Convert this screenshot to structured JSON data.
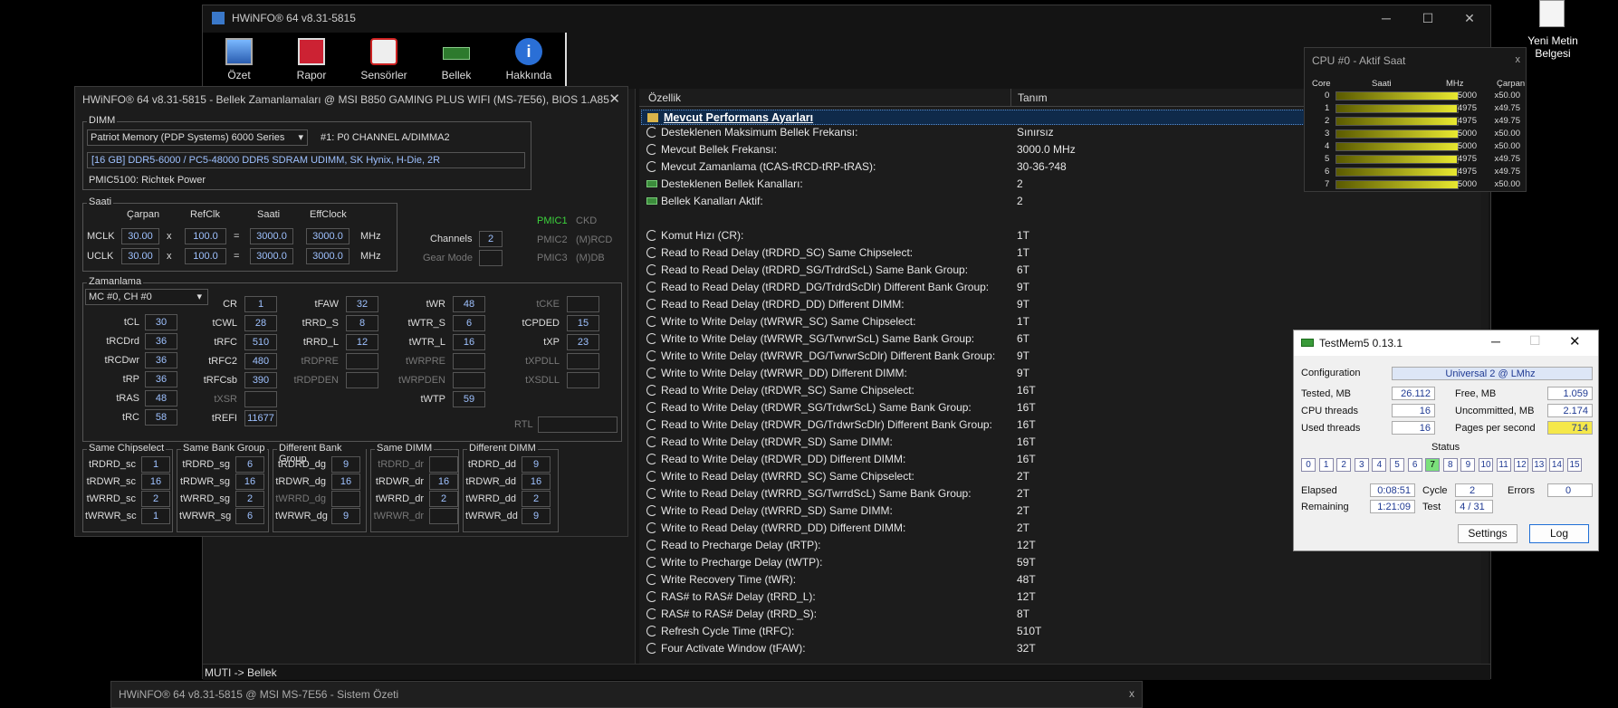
{
  "desktop": {
    "file_icon": "file-icon",
    "file_label1": "Yeni Metin",
    "file_label2": "Belgesi"
  },
  "main": {
    "title": "HWiNFO® 64 v8.31-5815",
    "toolbar": [
      {
        "label": "Özet",
        "icon": "monitor-icon"
      },
      {
        "label": "Rapor",
        "icon": "save-icon"
      },
      {
        "label": "Sensörler",
        "icon": "thermometer-icon"
      },
      {
        "label": "Bellek",
        "icon": "ram-icon"
      },
      {
        "label": "Hakkında",
        "icon": "info-icon"
      }
    ],
    "status": "MUTI -> Bellek",
    "table": {
      "col_feature": "Özellik",
      "col_desc": "Tanım",
      "section": "Mevcut Performans Ayarları",
      "rows": [
        {
          "icon": "clock",
          "name": "Desteklenen Maksimum Bellek Frekansı:",
          "value": "Sınırsız"
        },
        {
          "icon": "clock",
          "name": "Mevcut Bellek Frekansı:",
          "value": "3000.0 MHz"
        },
        {
          "icon": "clock",
          "name": "Mevcut Zamanlama (tCAS-tRCD-tRP-tRAS):",
          "value": "30-36-?48"
        },
        {
          "icon": "ram",
          "name": "Desteklenen Bellek Kanalları:",
          "value": "2"
        },
        {
          "icon": "ram",
          "name": "Bellek Kanalları Aktif:",
          "value": "2"
        },
        {
          "icon": "none",
          "name": "",
          "value": ""
        },
        {
          "icon": "clock",
          "name": "Komut Hızı (CR):",
          "value": "1T"
        },
        {
          "icon": "clock",
          "name": "Read to Read Delay (tRDRD_SC) Same Chipselect:",
          "value": "1T"
        },
        {
          "icon": "clock",
          "name": "Read to Read Delay (tRDRD_SG/TrdrdScL) Same Bank Group:",
          "value": "6T"
        },
        {
          "icon": "clock",
          "name": "Read to Read Delay (tRDRD_DG/TrdrdScDlr) Different Bank Group:",
          "value": "9T"
        },
        {
          "icon": "clock",
          "name": "Read to Read Delay (tRDRD_DD) Different DIMM:",
          "value": "9T"
        },
        {
          "icon": "clock",
          "name": "Write to Write Delay (tWRWR_SC) Same Chipselect:",
          "value": "1T"
        },
        {
          "icon": "clock",
          "name": "Write to Write Delay (tWRWR_SG/TwrwrScL) Same Bank Group:",
          "value": "6T"
        },
        {
          "icon": "clock",
          "name": "Write to Write Delay (tWRWR_DG/TwrwrScDlr) Different Bank Group:",
          "value": "9T"
        },
        {
          "icon": "clock",
          "name": "Write to Write Delay (tWRWR_DD) Different DIMM:",
          "value": "9T"
        },
        {
          "icon": "clock",
          "name": "Read to Write Delay (tRDWR_SC) Same Chipselect:",
          "value": "16T"
        },
        {
          "icon": "clock",
          "name": "Read to Write Delay (tRDWR_SG/TrdwrScL) Same Bank Group:",
          "value": "16T"
        },
        {
          "icon": "clock",
          "name": "Read to Write Delay (tRDWR_DG/TrdwrScDlr) Different Bank Group:",
          "value": "16T"
        },
        {
          "icon": "clock",
          "name": "Read to Write Delay (tRDWR_SD) Same DIMM:",
          "value": "16T"
        },
        {
          "icon": "clock",
          "name": "Read to Write Delay (tRDWR_DD) Different DIMM:",
          "value": "16T"
        },
        {
          "icon": "clock",
          "name": "Write to Read Delay (tWRRD_SC) Same Chipselect:",
          "value": "2T"
        },
        {
          "icon": "clock",
          "name": "Write to Read Delay (tWRRD_SG/TwrrdScL) Same Bank Group:",
          "value": "2T"
        },
        {
          "icon": "clock",
          "name": "Write to Read Delay (tWRRD_SD) Same DIMM:",
          "value": "2T"
        },
        {
          "icon": "clock",
          "name": "Write to Read Delay (tWRRD_DD) Different DIMM:",
          "value": "2T"
        },
        {
          "icon": "clock",
          "name": "Read to Precharge Delay (tRTP):",
          "value": "12T"
        },
        {
          "icon": "clock",
          "name": "Write to Precharge Delay (tWTP):",
          "value": "59T"
        },
        {
          "icon": "clock",
          "name": "Write Recovery Time (tWR):",
          "value": "48T"
        },
        {
          "icon": "clock",
          "name": "RAS# to RAS# Delay (tRRD_L):",
          "value": "12T"
        },
        {
          "icon": "clock",
          "name": "RAS# to RAS# Delay (tRRD_S):",
          "value": "8T"
        },
        {
          "icon": "clock",
          "name": "Refresh Cycle Time (tRFC):",
          "value": "510T"
        },
        {
          "icon": "clock",
          "name": "Four Activate Window (tFAW):",
          "value": "32T"
        }
      ]
    }
  },
  "bottom_window": {
    "title": "HWiNFO® 64 v8.31-5815 @ MSI MS-7E56 - Sistem Özeti",
    "close": "x"
  },
  "cpu_clock": {
    "title": "CPU #0 - Aktif Saat",
    "close": "x",
    "headers": [
      "Core",
      "Saati",
      "MHz",
      "Çarpan"
    ],
    "cores": [
      {
        "core": "0",
        "mhz": "5000",
        "mult": "x50.00",
        "fill": 1.0
      },
      {
        "core": "1",
        "mhz": "4975",
        "mult": "x49.75",
        "fill": 0.995
      },
      {
        "core": "2",
        "mhz": "4975",
        "mult": "x49.75",
        "fill": 0.995
      },
      {
        "core": "3",
        "mhz": "5000",
        "mult": "x50.00",
        "fill": 1.0
      },
      {
        "core": "4",
        "mhz": "5000",
        "mult": "x50.00",
        "fill": 1.0
      },
      {
        "core": "5",
        "mhz": "4975",
        "mult": "x49.75",
        "fill": 0.995
      },
      {
        "core": "6",
        "mhz": "4975",
        "mult": "x49.75",
        "fill": 0.995
      },
      {
        "core": "7",
        "mhz": "5000",
        "mult": "x50.00",
        "fill": 1.0
      }
    ]
  },
  "mem": {
    "title": "HWiNFO® 64 v8.31-5815 - Bellek Zamanlamaları @ MSI B850 GAMING PLUS WIFI (MS-7E56), BIOS 1.A85",
    "dimm": {
      "group": "DIMM",
      "select": "Patriot Memory (PDP Systems) 6000 Series",
      "slot": "#1: P0 CHANNEL A/DIMMA2",
      "desc": "[16 GB] DDR5-6000 / PC5-48000 DDR5 SDRAM UDIMM, SK Hynix, H-Die, 2R",
      "pmic": "PMIC5100: Richtek Power"
    },
    "clock": {
      "group": "Saati",
      "h_mult": "Çarpan",
      "h_ref": "RefClk",
      "h_clk": "Saati",
      "h_eff": "EffClock",
      "mclk": "MCLK",
      "uclk": "UCLK",
      "mclk_mult": "30.00",
      "mclk_ref": "100.0",
      "mclk_clk": "3000.0",
      "mclk_eff": "3000.0",
      "uclk_mult": "30.00",
      "uclk_ref": "100.0",
      "uclk_clk": "3000.0",
      "uclk_eff": "3000.0",
      "x": "x",
      "eq": "=",
      "mhz": "MHz",
      "channels_label": "Channels",
      "channels": "2",
      "gear_label": "Gear Mode",
      "gear": "",
      "pmic1": "PMIC1",
      "ckd": "CKD",
      "pmic2": "PMIC2",
      "rcd": "(M)RCD",
      "pmic3": "PMIC3",
      "db": "(M)DB"
    },
    "timing": {
      "group": "Zamanlama",
      "select": "MC #0, CH #0",
      "c1": [
        [
          "tCL",
          "30"
        ],
        [
          "tRCDrd",
          "36"
        ],
        [
          "tRCDwr",
          "36"
        ],
        [
          "tRP",
          "36"
        ],
        [
          "tRAS",
          "48"
        ],
        [
          "tRC",
          "58"
        ]
      ],
      "c2": [
        [
          "CR",
          "1"
        ],
        [
          "tCWL",
          "28"
        ],
        [
          "tRFC",
          "510"
        ],
        [
          "tRFC2",
          "480"
        ],
        [
          "tRFCsb",
          "390"
        ],
        [
          "tXSR",
          ""
        ],
        [
          "tREFI",
          "11677"
        ]
      ],
      "c3": [
        [
          "tFAW",
          "32"
        ],
        [
          "tRRD_S",
          "8"
        ],
        [
          "tRRD_L",
          "12"
        ],
        [
          "tRDPRE",
          ""
        ],
        [
          "tRDPDEN",
          ""
        ]
      ],
      "c4": [
        [
          "tWR",
          "48"
        ],
        [
          "tWTR_S",
          "6"
        ],
        [
          "tWTR_L",
          "16"
        ],
        [
          "tWRPRE",
          ""
        ],
        [
          "tWRPDEN",
          ""
        ],
        [
          "tWTP",
          "59"
        ]
      ],
      "c5": [
        [
          "tCKE",
          ""
        ],
        [
          "tCPDED",
          "15"
        ],
        [
          "tXP",
          "23"
        ],
        [
          "tXPDLL",
          ""
        ],
        [
          "tXSDLL",
          ""
        ]
      ],
      "rtl": "RTL"
    },
    "groups": [
      {
        "title": "Same Chipselect",
        "items": [
          [
            "tRDRD_sc",
            "1"
          ],
          [
            "tRDWR_sc",
            "16"
          ],
          [
            "tWRRD_sc",
            "2"
          ],
          [
            "tWRWR_sc",
            "1"
          ]
        ]
      },
      {
        "title": "Same Bank Group",
        "items": [
          [
            "tRDRD_sg",
            "6"
          ],
          [
            "tRDWR_sg",
            "16"
          ],
          [
            "tWRRD_sg",
            "2"
          ],
          [
            "tWRWR_sg",
            "6"
          ]
        ]
      },
      {
        "title": "Different Bank Group",
        "items": [
          [
            "tRDRD_dg",
            "9"
          ],
          [
            "tRDWR_dg",
            "16"
          ],
          [
            "tWRRD_dg",
            ""
          ],
          [
            "tWRWR_dg",
            "9"
          ]
        ]
      },
      {
        "title": "Same DIMM",
        "items": [
          [
            "tRDRD_dr",
            ""
          ],
          [
            "tRDWR_dr",
            "16"
          ],
          [
            "tWRRD_dr",
            "2"
          ],
          [
            "tWRWR_dr",
            ""
          ]
        ]
      },
      {
        "title": "Different DIMM",
        "items": [
          [
            "tRDRD_dd",
            "9"
          ],
          [
            "tRDWR_dd",
            "16"
          ],
          [
            "tWRRD_dd",
            "2"
          ],
          [
            "tWRWR_dd",
            "9"
          ]
        ]
      }
    ]
  },
  "testmem": {
    "title": "TestMem5  0.13.1",
    "config_label": "Configuration",
    "config": "Universal 2 @ LMhz",
    "tested_label": "Tested, MB",
    "tested": "26.112",
    "free_label": "Free, MB",
    "free": "1.059",
    "cpu_label": "CPU threads",
    "cpu": "16",
    "uncommitted_label": "Uncommitted, MB",
    "uncommitted": "2.174",
    "used_label": "Used threads",
    "used": "16",
    "pps_label": "Pages per second",
    "pps": "714",
    "status_label": "Status",
    "status": [
      "0",
      "1",
      "2",
      "3",
      "4",
      "5",
      "6",
      "7",
      "8",
      "9",
      "10",
      "11",
      "12",
      "13",
      "14",
      "15"
    ],
    "active": "7",
    "elapsed_label": "Elapsed",
    "elapsed": "0:08:51",
    "cycle_label": "Cycle",
    "cycle": "2",
    "errors_label": "Errors",
    "errors": "0",
    "remaining_label": "Remaining",
    "remaining": "1:21:09",
    "test_label": "Test",
    "test": "4 / 31",
    "settings": "Settings",
    "log": "Log"
  }
}
